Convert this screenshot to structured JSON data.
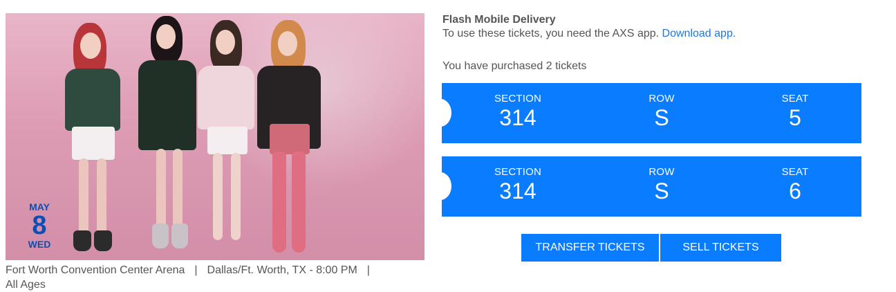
{
  "event": {
    "date": {
      "month": "MAY",
      "day": "8",
      "weekday": "WED"
    },
    "venue": "Fort Worth Convention Center Arena",
    "location_time": "Dallas/Ft. Worth, TX - 8:00 PM",
    "age_restriction": "All Ages",
    "separator": "|"
  },
  "delivery": {
    "title": "Flash Mobile Delivery",
    "text": "To use these tickets, you need the AXS app.",
    "link_label": "Download app.",
    "link_color": "#1f78e0"
  },
  "purchase": {
    "summary": "You have purchased 2 tickets"
  },
  "tickets": [
    {
      "section_label": "SECTION",
      "section": "314",
      "row_label": "ROW",
      "row": "S",
      "seat_label": "SEAT",
      "seat": "5"
    },
    {
      "section_label": "SECTION",
      "section": "314",
      "row_label": "ROW",
      "row": "S",
      "seat_label": "SEAT",
      "seat": "6"
    }
  ],
  "actions": {
    "transfer_label": "TRANSFER TICKETS",
    "sell_label": "SELL TICKETS"
  },
  "colors": {
    "accent": "#0a7cff",
    "date_badge": "#0a4fb5",
    "text": "#555555"
  }
}
